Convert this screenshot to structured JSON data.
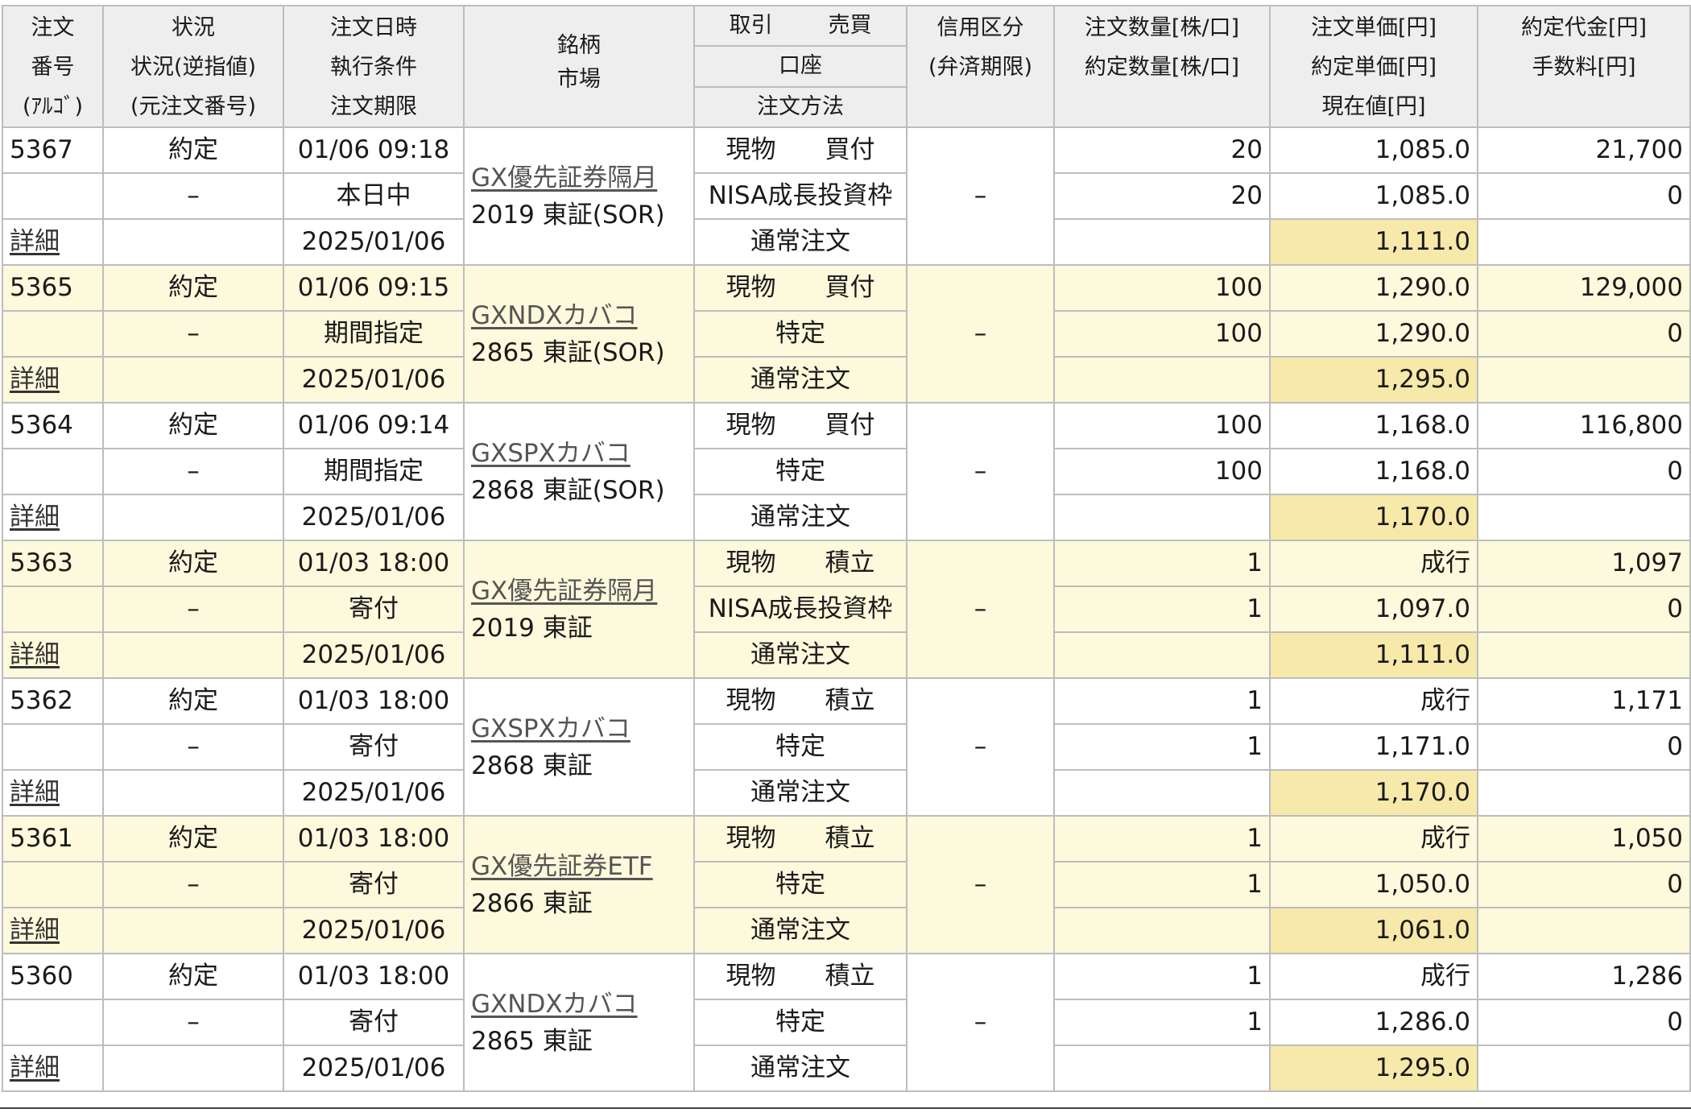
{
  "header": {
    "order_no": [
      "注文",
      "番号",
      "(ｱﾙｺﾞ)"
    ],
    "status": [
      "状況",
      "状況(逆指値)",
      "(元注文番号)"
    ],
    "datetime": [
      "注文日時",
      "執行条件",
      "注文期限"
    ],
    "brand": [
      "銘柄",
      "市場"
    ],
    "trade_label": "取引",
    "side_label": "売買",
    "account_label": "口座",
    "method_label": "注文方法",
    "credit": [
      "信用区分",
      "(弁済期限)"
    ],
    "qty": [
      "注文数量[株/口]",
      "約定数量[株/口]"
    ],
    "price": [
      "注文単価[円]",
      "約定単価[円]",
      "現在値[円]"
    ],
    "amount": [
      "約定代金[円]",
      "手数料[円]"
    ]
  },
  "detail_label": "詳細",
  "orders": [
    {
      "order_no": "5367",
      "status": "約定",
      "status_stop": "–",
      "order_time": "01/06  09:18",
      "condition": "本日中",
      "deadline": "2025/01/06",
      "name": "GX優先証券隔月",
      "code_market": "2019 東証(SOR)",
      "trade": "現物",
      "side": "買付",
      "account": "NISA成長投資枠",
      "method": "通常注文",
      "credit": "–",
      "order_qty": "20",
      "exec_qty": "20",
      "order_price": "1,085.0",
      "exec_price": "1,085.0",
      "current_price": "1,111.0",
      "amount": "21,700",
      "fee": "0"
    },
    {
      "order_no": "5365",
      "status": "約定",
      "status_stop": "–",
      "order_time": "01/06  09:15",
      "condition": "期間指定",
      "deadline": "2025/01/06",
      "name": "GXNDXカバコ",
      "code_market": "2865 東証(SOR)",
      "trade": "現物",
      "side": "買付",
      "account": "特定",
      "method": "通常注文",
      "credit": "–",
      "order_qty": "100",
      "exec_qty": "100",
      "order_price": "1,290.0",
      "exec_price": "1,290.0",
      "current_price": "1,295.0",
      "amount": "129,000",
      "fee": "0"
    },
    {
      "order_no": "5364",
      "status": "約定",
      "status_stop": "–",
      "order_time": "01/06  09:14",
      "condition": "期間指定",
      "deadline": "2025/01/06",
      "name": "GXSPXカバコ",
      "code_market": "2868 東証(SOR)",
      "trade": "現物",
      "side": "買付",
      "account": "特定",
      "method": "通常注文",
      "credit": "–",
      "order_qty": "100",
      "exec_qty": "100",
      "order_price": "1,168.0",
      "exec_price": "1,168.0",
      "current_price": "1,170.0",
      "amount": "116,800",
      "fee": "0"
    },
    {
      "order_no": "5363",
      "status": "約定",
      "status_stop": "–",
      "order_time": "01/03  18:00",
      "condition": "寄付",
      "deadline": "2025/01/06",
      "name": "GX優先証券隔月",
      "code_market": "2019 東証",
      "trade": "現物",
      "side": "積立",
      "account": "NISA成長投資枠",
      "method": "通常注文",
      "credit": "–",
      "order_qty": "1",
      "exec_qty": "1",
      "order_price": "成行",
      "exec_price": "1,097.0",
      "current_price": "1,111.0",
      "amount": "1,097",
      "fee": "0"
    },
    {
      "order_no": "5362",
      "status": "約定",
      "status_stop": "–",
      "order_time": "01/03  18:00",
      "condition": "寄付",
      "deadline": "2025/01/06",
      "name": "GXSPXカバコ",
      "code_market": "2868 東証",
      "trade": "現物",
      "side": "積立",
      "account": "特定",
      "method": "通常注文",
      "credit": "–",
      "order_qty": "1",
      "exec_qty": "1",
      "order_price": "成行",
      "exec_price": "1,171.0",
      "current_price": "1,170.0",
      "amount": "1,171",
      "fee": "0"
    },
    {
      "order_no": "5361",
      "status": "約定",
      "status_stop": "–",
      "order_time": "01/03  18:00",
      "condition": "寄付",
      "deadline": "2025/01/06",
      "name": "GX優先証券ETF",
      "code_market": "2866 東証",
      "trade": "現物",
      "side": "積立",
      "account": "特定",
      "method": "通常注文",
      "credit": "–",
      "order_qty": "1",
      "exec_qty": "1",
      "order_price": "成行",
      "exec_price": "1,050.0",
      "current_price": "1,061.0",
      "amount": "1,050",
      "fee": "0"
    },
    {
      "order_no": "5360",
      "status": "約定",
      "status_stop": "–",
      "order_time": "01/03  18:00",
      "condition": "寄付",
      "deadline": "2025/01/06",
      "name": "GXNDXカバコ",
      "code_market": "2865 東証",
      "trade": "現物",
      "side": "積立",
      "account": "特定",
      "method": "通常注文",
      "credit": "–",
      "order_qty": "1",
      "exec_qty": "1",
      "order_price": "成行",
      "exec_price": "1,286.0",
      "current_price": "1,295.0",
      "amount": "1,286",
      "fee": "0"
    }
  ]
}
